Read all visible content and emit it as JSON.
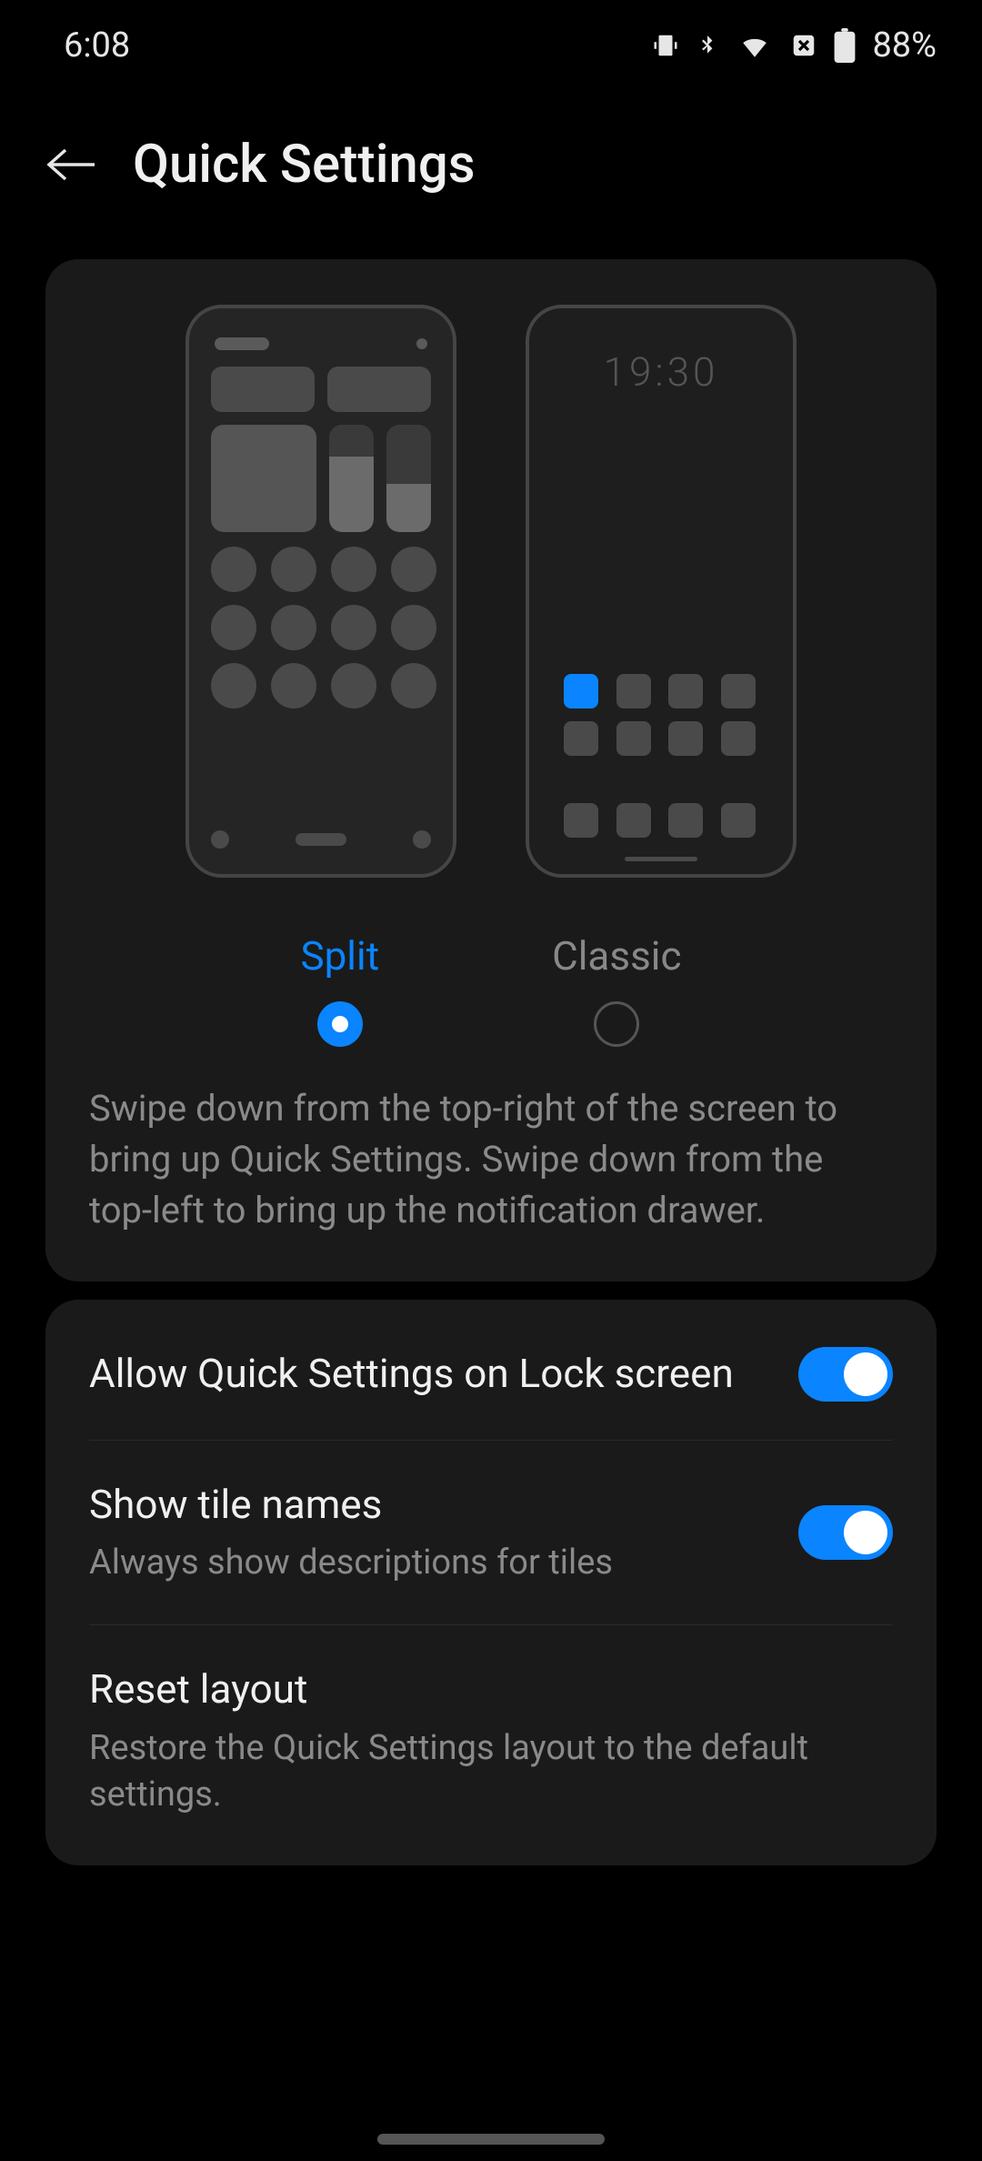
{
  "status": {
    "time": "6:08",
    "battery": "88%"
  },
  "header": {
    "title": "Quick Settings"
  },
  "layout_card": {
    "classic_time": "19:30",
    "options": {
      "split": "Split",
      "classic": "Classic"
    },
    "description": "Swipe down from the top-right of the screen to bring up Quick Settings. Swipe down from the top-left to bring up the notification drawer."
  },
  "settings": {
    "lock_screen": {
      "title": "Allow Quick Settings on Lock screen"
    },
    "tile_names": {
      "title": "Show tile names",
      "sub": "Always show descriptions for tiles"
    },
    "reset": {
      "title": "Reset layout",
      "sub": "Restore the Quick Settings layout to the default settings."
    }
  }
}
